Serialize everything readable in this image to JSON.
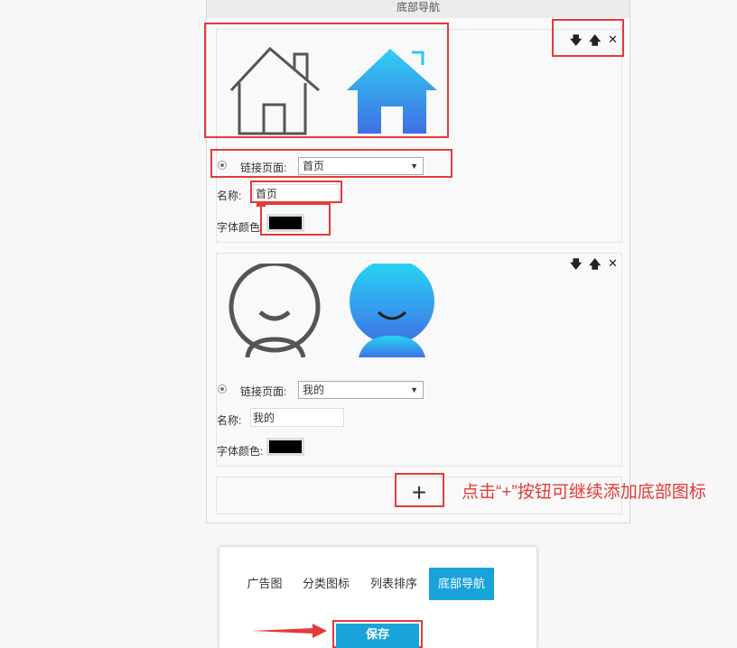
{
  "panel": {
    "title": "底部导航"
  },
  "items": [
    {
      "controls": {
        "down": "🡇",
        "up": "🡅",
        "close": "✕"
      },
      "link_label": "链接页面:",
      "link_value": "首页",
      "name_label": "名称:",
      "name_value": "首页",
      "color_label": "字体颜色",
      "font_color": "#000000"
    },
    {
      "controls": {
        "down": "🡇",
        "up": "🡅",
        "close": "✕"
      },
      "link_label": "链接页面:",
      "link_value": "我的",
      "name_label": "名称:",
      "name_value": "我的",
      "color_label": "字体颜色:",
      "font_color": "#000000"
    }
  ],
  "add_button": "+",
  "annotation": "点击“+”按钮可继续添加底部图标",
  "tabs": [
    "广告图",
    "分类图标",
    "列表排序",
    "底部导航"
  ],
  "active_tab": "底部导航",
  "save_label": "保存",
  "colors": {
    "accent": "#1aa3d9",
    "highlight": "#e23b3b"
  }
}
